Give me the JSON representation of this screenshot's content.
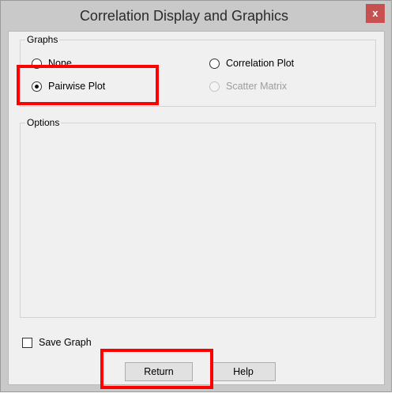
{
  "window": {
    "title": "Correlation Display and Graphics",
    "close_label": "x"
  },
  "graphs": {
    "label": "Graphs",
    "options": [
      {
        "label": "None",
        "checked": false,
        "disabled": false
      },
      {
        "label": "Pairwise Plot",
        "checked": true,
        "disabled": false
      },
      {
        "label": "Correlation Plot",
        "checked": false,
        "disabled": false
      },
      {
        "label": "Scatter Matrix",
        "checked": false,
        "disabled": true
      }
    ]
  },
  "options_group": {
    "label": "Options"
  },
  "save_graph": {
    "label": "Save Graph",
    "checked": false
  },
  "buttons": {
    "return_label": "Return",
    "help_label": "Help"
  },
  "annotation_color": "#ff0000"
}
